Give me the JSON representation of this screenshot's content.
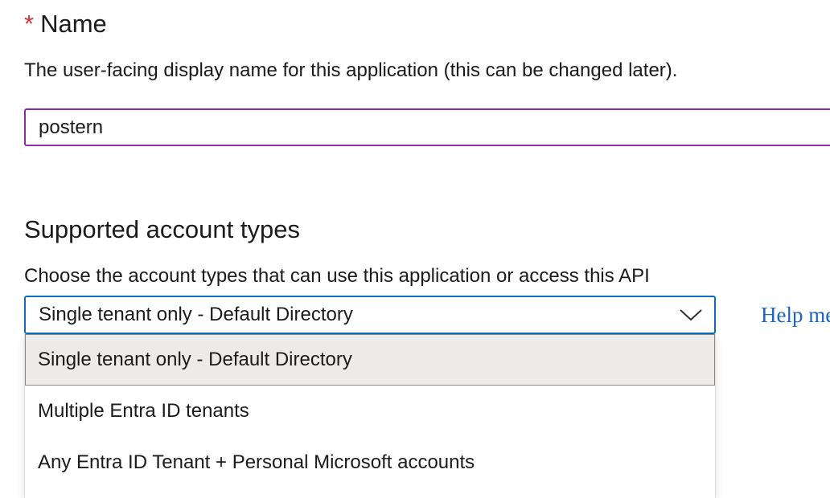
{
  "name_section": {
    "required_mark": "*",
    "heading": "Name",
    "description": "The user-facing display name for this application (this can be changed later).",
    "input_value": "postern"
  },
  "account_types": {
    "heading": "Supported account types",
    "description": "Choose the account types that can use this application or access this API",
    "selected_value": "Single tenant only - Default Directory",
    "help_link": "Help me",
    "options": [
      {
        "label": "Single tenant only - Default Directory",
        "selected": true
      },
      {
        "label": "Multiple Entra ID tenants",
        "selected": false
      },
      {
        "label": "Any Entra ID Tenant + Personal Microsoft accounts",
        "selected": false
      }
    ]
  },
  "colors": {
    "required": "#d13438",
    "name_field_border": "#8a2da5",
    "select_border": "#0f6cbd",
    "link": "#1966c8",
    "selected_option_bg": "#edebe9"
  },
  "icons": {
    "select_toggle": "chevron-down-icon"
  }
}
